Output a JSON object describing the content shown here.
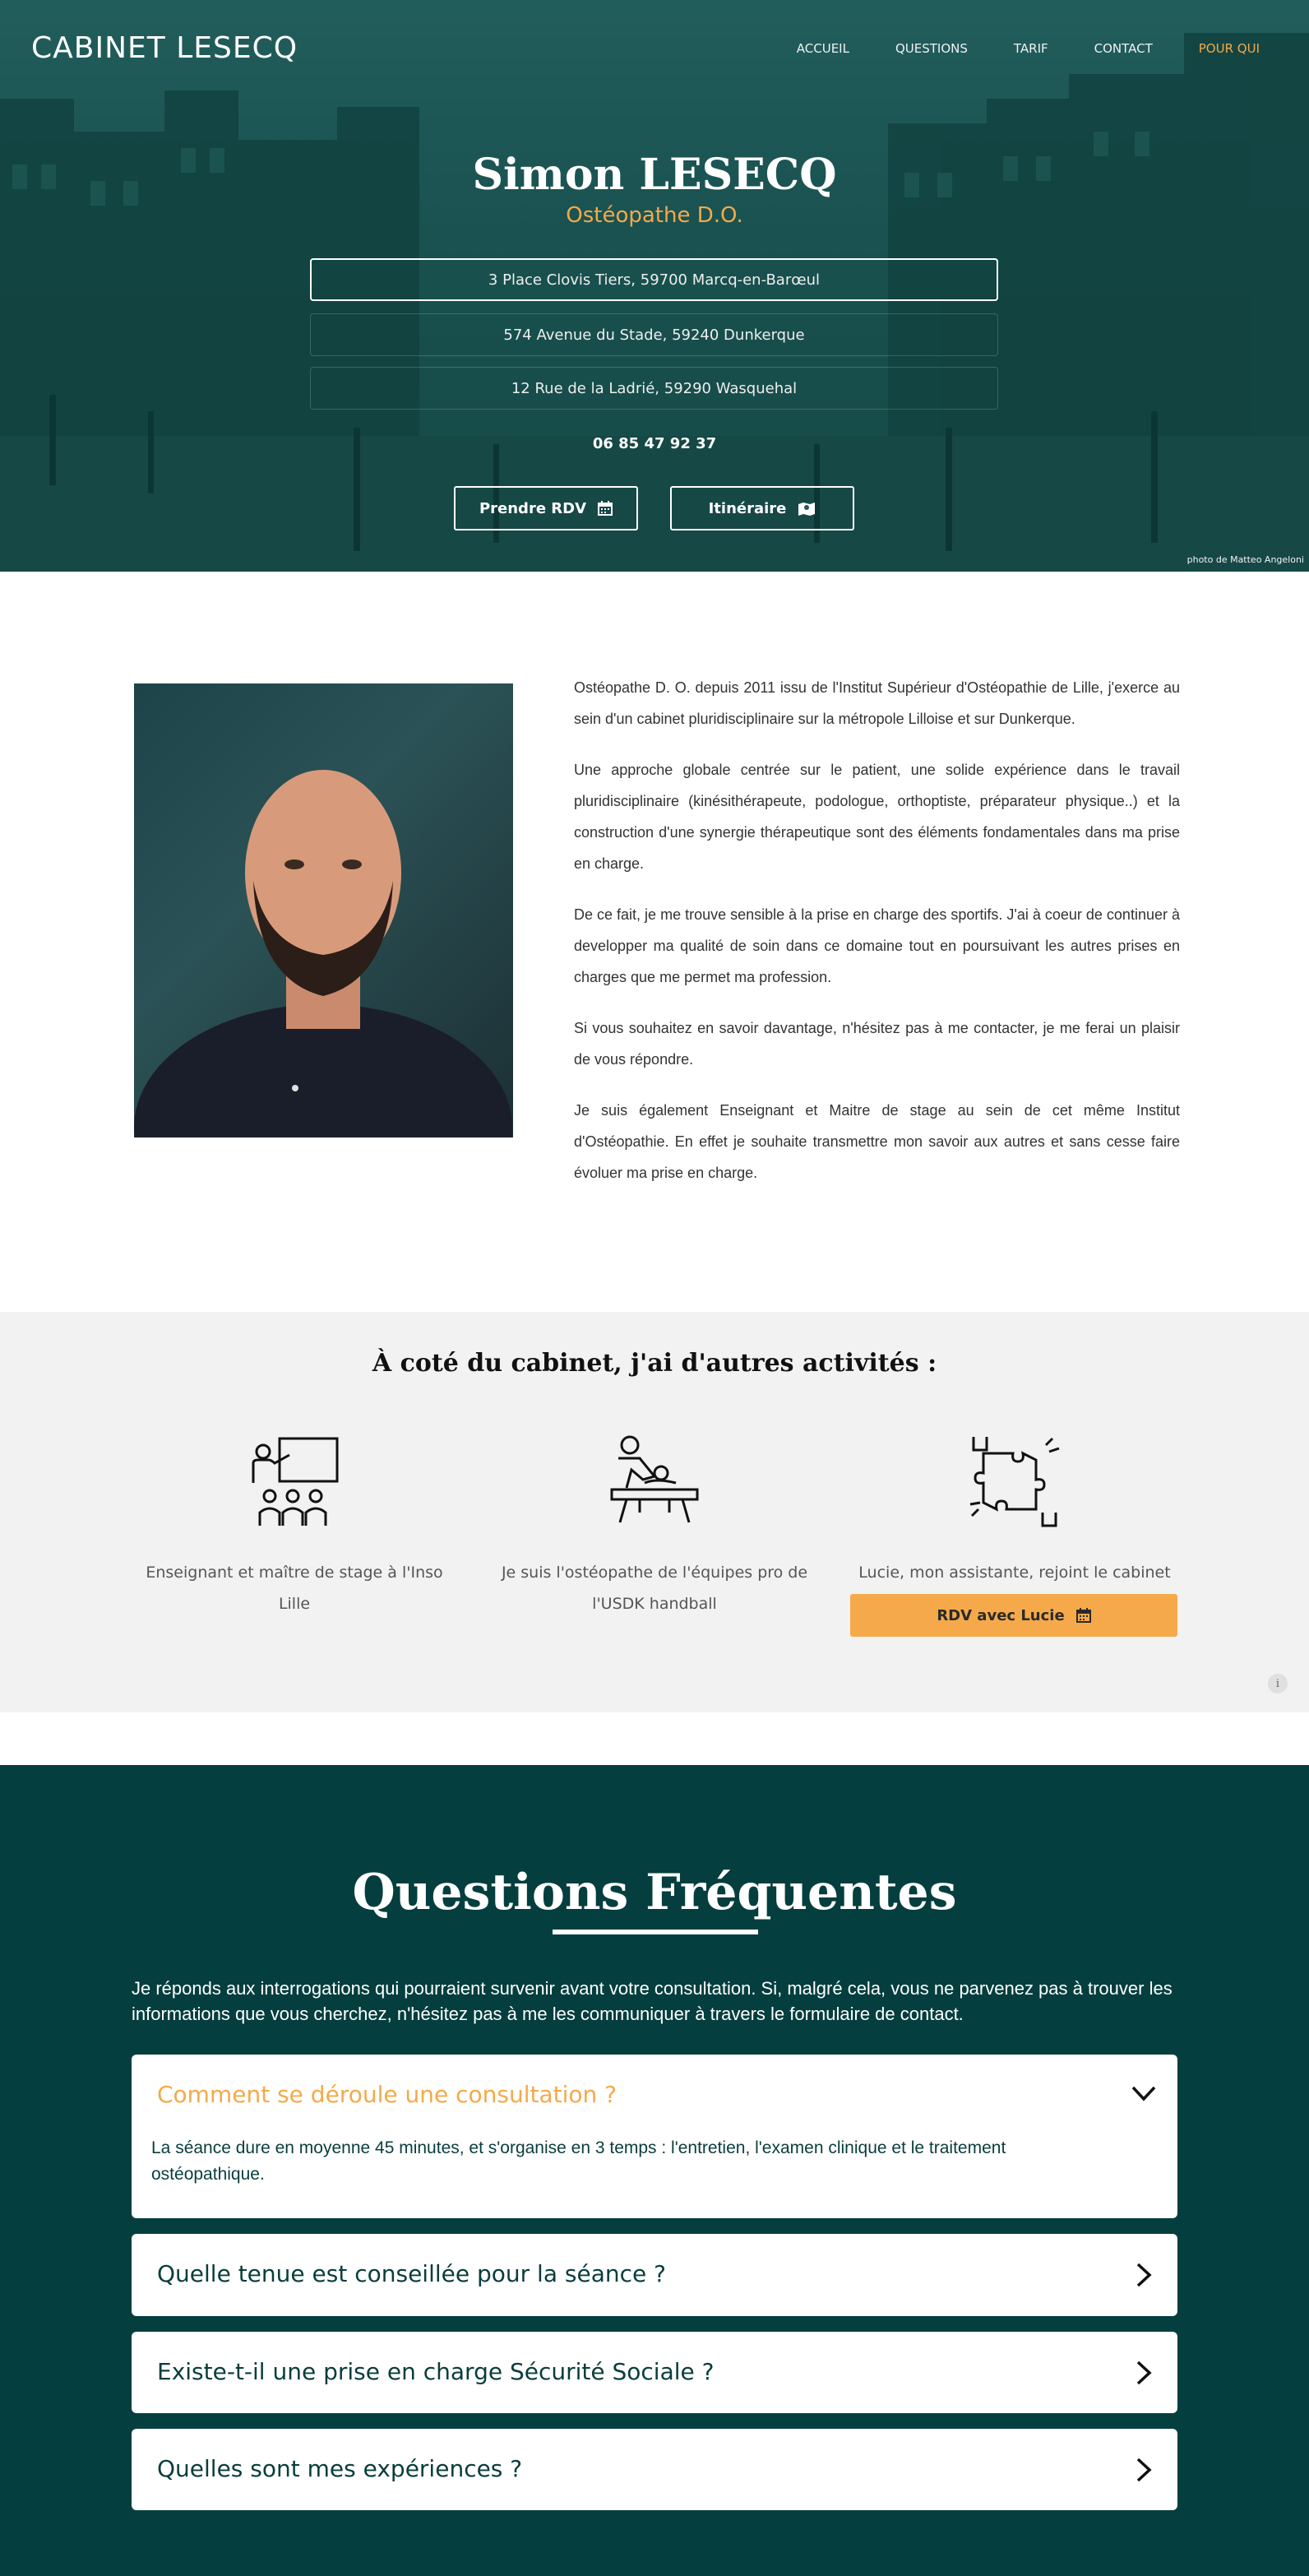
{
  "header": {
    "logo": "CABINET LESECQ",
    "nav": [
      {
        "label": "ACCUEIL"
      },
      {
        "label": "QUESTIONS"
      },
      {
        "label": "TARIF"
      },
      {
        "label": "CONTACT"
      },
      {
        "label": "POUR QUI"
      }
    ]
  },
  "hero": {
    "name": "Simon LESECQ",
    "subtitle": "Ostéopathe D.O.",
    "addresses": [
      "3 Place Clovis Tiers, 59700 Marcq-en-Barœul",
      "574 Avenue du Stade, 59240 Dunkerque",
      "12 Rue de la Ladrié, 59290 Wasquehal"
    ],
    "phone": "06 85 47 92 37",
    "btn_rdv": "Prendre RDV",
    "btn_itineraire": "Itinéraire",
    "photo_credit": "photo de Matteo Angeloni",
    "icons": {
      "rdv": "calendar-icon",
      "itineraire": "map-icon"
    }
  },
  "about": {
    "paragraphs": [
      "Ostéopathe D. O. depuis 2011 issu de l'Institut Supérieur d'Ostéopathie de Lille, j'exerce au sein d'un cabinet pluridisciplinaire sur la métropole Lilloise et sur Dunkerque.",
      "Une approche globale centrée sur le patient, une solide expérience dans le travail pluridisciplinaire (kinésithérapeute, podologue, orthoptiste, préparateur physique..) et la construction d'une synergie thérapeutique sont des éléments fondamentales dans ma prise en charge.",
      "De ce fait, je me trouve sensible à la prise en charge des sportifs. J'ai à coeur de continuer à developper ma qualité de soin dans ce domaine tout en poursuivant les autres prises en charges que me permet ma profession.",
      "Si vous souhaitez en savoir davantage, n'hésitez pas à me contacter, je me ferai un plaisir de vous répondre.",
      "Je suis également Enseignant et Maitre de stage au sein de cet même Institut d'Ostéopathie. En effet je souhaite transmettre mon savoir aux autres et sans cesse faire évoluer ma prise en charge."
    ]
  },
  "activities": {
    "title": "À coté du cabinet, j'ai d'autres activités :",
    "items": [
      {
        "icon": "teacher-icon",
        "text": "Enseignant et maître de stage à l'Inso Lille"
      },
      {
        "icon": "osteopathy-treatment-icon",
        "text": "Je suis l'ostéopathe de l'équipes pro de l'USDK handball"
      },
      {
        "icon": "puzzle-teamwork-icon",
        "text": "Lucie, mon assistante, rejoint le cabinet"
      }
    ],
    "lucie_btn": "RDV avec Lucie",
    "info": "i"
  },
  "faq": {
    "title": "Questions Fréquentes",
    "intro": "Je réponds aux interrogations qui pourraient survenir avant votre consultation. Si, malgré cela, vous ne parvenez pas à trouver les informations que vous cherchez, n'hésitez pas à me les communiquer à travers le formulaire de contact.",
    "items": [
      {
        "question": "Comment se déroule une consultation ?",
        "answer": "La séance dure en moyenne 45 minutes, et s'organise en 3 temps : l'entretien, l'examen clinique et le traitement ostéopathique.",
        "open": true
      },
      {
        "question": "Quelle tenue est conseillée pour la séance ?",
        "open": false
      },
      {
        "question": "Existe-t-il une prise en charge Sécurité Sociale ?",
        "open": false
      },
      {
        "question": "Quelles sont mes expériences ?",
        "open": false
      }
    ]
  },
  "colors": {
    "accent": "#f5a94a",
    "primary": "#053e3e"
  }
}
